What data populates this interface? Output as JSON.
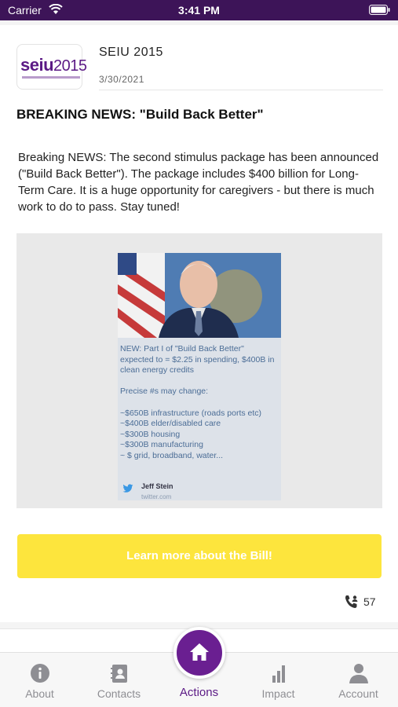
{
  "status_bar": {
    "carrier": "Carrier",
    "time": "3:41 PM"
  },
  "post": {
    "logo_text": "seiu",
    "logo_year": "2015",
    "org_name": "SEIU 2015",
    "date": "3/30/2021",
    "headline": "BREAKING NEWS:  \"Build Back Better\"",
    "body": "Breaking NEWS:  The second stimulus package has been announced (\"Build Back Better\").  The package includes $400 billion for Long-Term Care.  It is a huge opportunity for caregivers - but there is much work to do to pass.  Stay tuned!",
    "tweet": {
      "text": "NEW: Part I of \"Build Back Better\" expected to = $2.25 in spending, $400B in clean energy credits\n\nPrecise #s may change:\n\n~$650B infrastructure (roads ports etc)\n~$400B elder/disabled care\n~$300B housing\n~$300B manufacturing\n~ $ grid, broadband, water...",
      "author": "Jeff Stein",
      "source": "twitter.com"
    },
    "cta_label": "Learn more about the Bill!",
    "call_count": "57"
  },
  "tabs": [
    {
      "label": "About",
      "icon": "info-icon"
    },
    {
      "label": "Contacts",
      "icon": "contacts-icon"
    },
    {
      "label": "Actions",
      "icon": "home-icon",
      "active": true
    },
    {
      "label": "Impact",
      "icon": "bar-chart-icon"
    },
    {
      "label": "Account",
      "icon": "person-icon"
    }
  ],
  "colors": {
    "brand_purple": "#6a1f91",
    "cta_yellow": "#fde53d",
    "status_bar": "#3d1458"
  }
}
